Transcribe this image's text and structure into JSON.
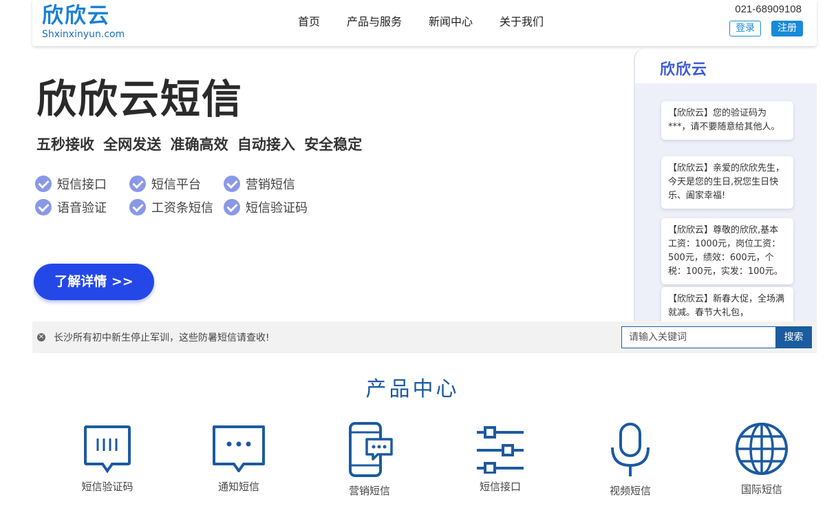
{
  "header": {
    "logo_cn": "欣欣云",
    "logo_en": "Shxinxinyun.com",
    "nav": [
      "首页",
      "产品与服务",
      "新闻中心",
      "关于我们"
    ],
    "phone": "021-68909108",
    "login_label": "登录",
    "register_label": "注册"
  },
  "banner": {
    "title": "欣欣云短信",
    "subtitle": "五秒接收 全网发送 准确高效 自动接入 安全稳定",
    "features": [
      "短信接口",
      "短信平台",
      "营销短信",
      "语音验证",
      "工资条短信",
      "短信验证码"
    ],
    "detail_button": "了解详情 >>",
    "accent_color": "#2448e8",
    "phone_mock": {
      "logo": "欣欣云",
      "messages": [
        "【欣欣云】您的验证码为***，请不要随意给其他人。",
        "【欣欣云】亲爱的欣欣先生，今天是您的生日,祝您生日快乐、阖家幸福!",
        "【欣欣云】尊敬的欣欣,基本工资：1000元，岗位工资：500元，绩效：600元，个税：100元，实发：100元。",
        "【欣欣云】新春大促，全场满就减。春节大礼包，"
      ]
    }
  },
  "notice": {
    "text": "长沙所有初中新生停止军训，这些防暑短信请查收!",
    "search_placeholder": "请输入关键词",
    "search_button": "搜索"
  },
  "products": {
    "title": "产品中心",
    "items": [
      {
        "label": "短信验证码",
        "icon": "sms-code-icon"
      },
      {
        "label": "通知短信",
        "icon": "notification-message-icon"
      },
      {
        "label": "营销短信",
        "icon": "marketing-phone-icon"
      },
      {
        "label": "短信接口",
        "icon": "sliders-icon"
      },
      {
        "label": "视频短信",
        "icon": "microphone-icon"
      },
      {
        "label": "国际短信",
        "icon": "globe-icon"
      }
    ],
    "icon_color": "#1c5aa0"
  }
}
